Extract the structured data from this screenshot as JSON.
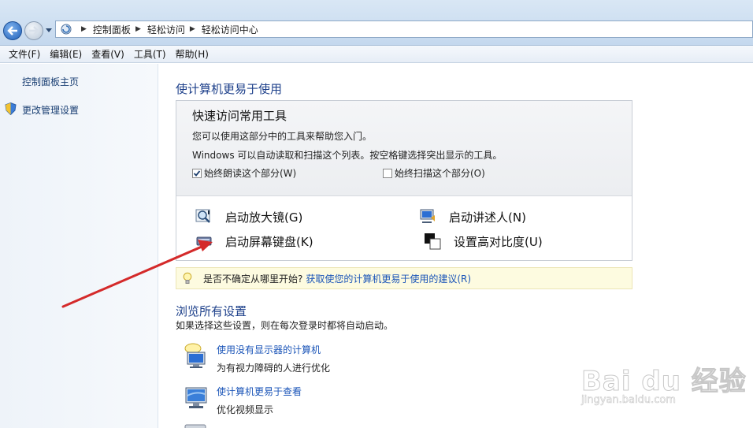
{
  "address_bar": {
    "crumbs": [
      "控制面板",
      "轻松访问",
      "轻松访问中心"
    ]
  },
  "menu": {
    "items": [
      "文件(F)",
      "编辑(E)",
      "查看(V)",
      "工具(T)",
      "帮助(H)"
    ]
  },
  "left_pane": {
    "home_link": "控制面板主页",
    "admin_link": "更改管理设置"
  },
  "main": {
    "heading": "使计算机更易于使用",
    "quick_tools": {
      "title": "快速访问常用工具",
      "line1": "您可以使用这部分中的工具来帮助您入门。",
      "line2": "Windows 可以自动读取和扫描这个列表。按空格键选择突出显示的工具。",
      "checkbox_read": {
        "label": "始终朗读这个部分(W)",
        "checked": true
      },
      "checkbox_scan": {
        "label": "始终扫描这个部分(O)",
        "checked": false
      },
      "tools": {
        "magnifier": "启动放大镜(G)",
        "keyboard": "启动屏幕键盘(K)",
        "narrator": "启动讲述人(N)",
        "contrast": "设置高对比度(U)"
      }
    },
    "tip": {
      "question": "是否不确定从哪里开始?",
      "link": "获取使您的计算机更易于使用的建议(R)"
    },
    "browse": {
      "heading": "浏览所有设置",
      "description": "如果选择这些设置，则在每次登录时都将自动启动。",
      "items": [
        {
          "link": "使用没有显示器的计算机",
          "desc": "为有视力障碍的人进行优化"
        },
        {
          "link": "使计算机更易于查看",
          "desc": "优化视频显示"
        }
      ]
    }
  },
  "watermark": {
    "main": "Bai du 经验",
    "sub": "jingyan.baidu.com"
  },
  "colors": {
    "link": "#1b55b8",
    "heading": "#1c3f8a",
    "arrow": "#d42a2a",
    "tip_bg": "#fdfbe0"
  }
}
